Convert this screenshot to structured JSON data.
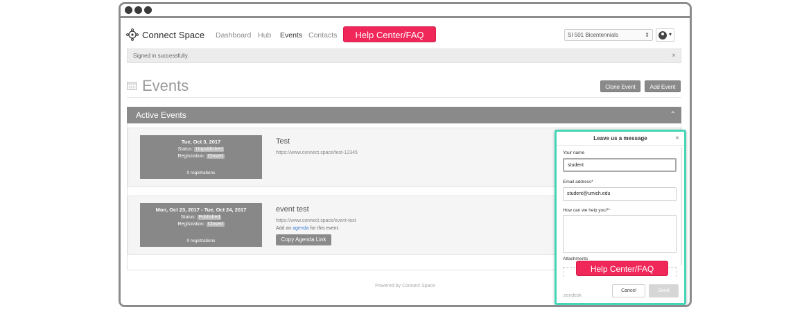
{
  "colors": {
    "accent": "#f0285a",
    "widget_border": "#45d6b8",
    "gray": "#8a8a8a"
  },
  "nav": {
    "brand": "Connect Space",
    "links": [
      "Dashboard",
      "Hub",
      "Events",
      "Contacts"
    ],
    "active_link": "Events",
    "help_button": "Help Center/FAQ",
    "space_select": "SI 501 Bicentennials"
  },
  "alert": {
    "message": "Signed in successfully.",
    "close": "×"
  },
  "page": {
    "title": "Events",
    "clone_button": "Clone Event",
    "add_button": "Add Event"
  },
  "section": {
    "title": "Active Events",
    "chevron": "⌃"
  },
  "events": [
    {
      "date": "Tue, Oct 3, 2017",
      "status_label": "Status:",
      "status": "Unpublished",
      "registration_label": "Registration:",
      "registration": "Closed",
      "registrations": "0 registrations",
      "title": "Test",
      "url": "https://www.connect.space/test-12345"
    },
    {
      "date": "Mon, Oct 23, 2017 - Tue, Oct 24, 2017",
      "status_label": "Status:",
      "status": "Published",
      "registration_label": "Registration:",
      "registration": "Closed",
      "registrations": "0 registrations",
      "title": "event test",
      "url": "https://www.connect.space/event-test",
      "agenda_prefix": "Add an ",
      "agenda_link": "agenda",
      "agenda_suffix": " for this event.",
      "copy_button": "Copy Agenda Link"
    }
  ],
  "footer": "Powered by Connect Space",
  "widget": {
    "title": "Leave us a message",
    "close": "×",
    "name_label": "Your name",
    "name_value": "student",
    "email_label": "Email address*",
    "email_value": "student@umich.edu",
    "help_label": "How can we help you?*",
    "attachments_label": "Attachments",
    "help_button": "Help Center/FAQ",
    "brand": "zendesk",
    "cancel": "Cancel",
    "send": "Send"
  }
}
